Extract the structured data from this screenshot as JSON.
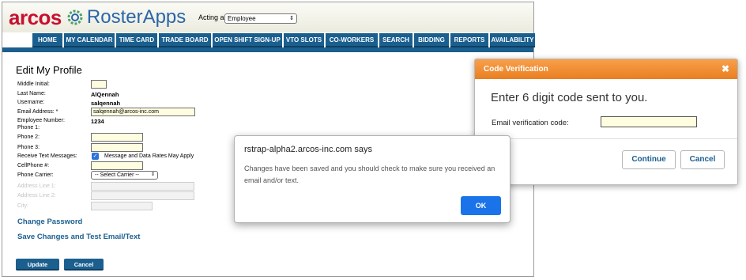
{
  "brand": {
    "arcos": "arcos",
    "roster": "RosterApps"
  },
  "acting": {
    "label": "Acting as",
    "selected": "Employee"
  },
  "nav": [
    "HOME",
    "MY CALENDAR",
    "TIME CARD",
    "TRADE BOARD",
    "OPEN SHIFT SIGN-UP",
    "VTO SLOTS",
    "CO-WORKERS",
    "SEARCH",
    "BIDDING",
    "REPORTS",
    "AVAILABILITY"
  ],
  "profile": {
    "title": "Edit My Profile",
    "middle_initial_label": "Middle Initial:",
    "middle_initial_value": "",
    "last_name_label": "Last Name:",
    "last_name_value": "AlQennah",
    "username_label": "Username:",
    "username_value": "salqennah",
    "email_label": "Email Address: *",
    "email_value": "salqennah@arcos-inc.com",
    "employee_number_label": "Employee Number:",
    "employee_number_value": "1234",
    "phone1_label": "Phone 1:",
    "phone2_label": "Phone 2:",
    "phone3_label": "Phone 3:",
    "receive_text_label": "Receive Text Messages:",
    "receive_text_note": "Message and Data Rates May Apply",
    "cellphone_label": "CellPhone #:",
    "carrier_label": "Phone Carrier:",
    "carrier_value": "-- Select Carrier --",
    "address1_label": "Address Line 1:",
    "address2_label": "Address Line 2:",
    "city_label": "City:",
    "change_password": "Change Password",
    "save_test": "Save Changes and Test Email/Text",
    "update": "Update",
    "cancel": "Cancel"
  },
  "modal": {
    "title": "Code Verification",
    "close": "✖",
    "message": "Enter 6 digit code sent to you.",
    "field_label": "Email verification code:",
    "field_value": "",
    "continue": "Continue",
    "cancel": "Cancel"
  },
  "alert": {
    "title": "rstrap-alpha2.arcos-inc.com says",
    "body": "Changes have been saved and you should check to make sure you received an email and/or text.",
    "ok": "OK"
  },
  "colors": {
    "nav": "#1b5f8f",
    "brand_red": "#c8102e",
    "brand_blue": "#2a66a8",
    "modal_header": "#ea7e21",
    "alert_button": "#1a73e8"
  }
}
